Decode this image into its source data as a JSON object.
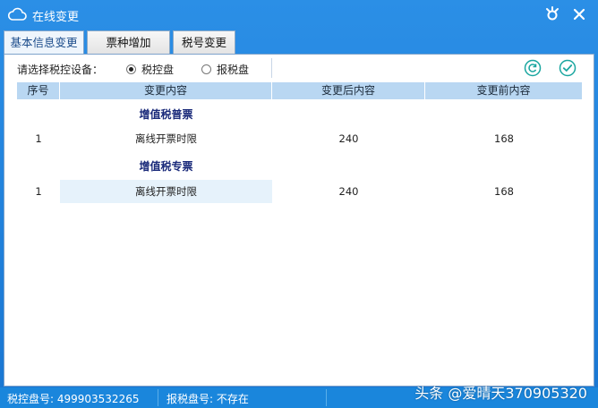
{
  "window": {
    "title": "在线变更",
    "cloud_icon": "cloud-icon",
    "settings_icon": "settings-icon",
    "close_icon": "close-icon"
  },
  "tabs": [
    {
      "label": "基本信息变更",
      "active": true
    },
    {
      "label": "票种增加",
      "active": false
    },
    {
      "label": "税号变更",
      "active": false
    }
  ],
  "device": {
    "label": "请选择税控设备：",
    "options": [
      {
        "label": "税控盘",
        "selected": true
      },
      {
        "label": "报税盘",
        "selected": false
      }
    ]
  },
  "toolbar": {
    "refresh_icon": "refresh-icon",
    "confirm_icon": "check-icon"
  },
  "table": {
    "headers": [
      "序号",
      "变更内容",
      "变更后内容",
      "变更前内容"
    ],
    "groups": [
      {
        "title": "增值税普票",
        "rows": [
          [
            "1",
            "离线开票时限",
            "240",
            "168"
          ]
        ]
      },
      {
        "title": "增值税专票",
        "rows": [
          [
            "1",
            "离线开票时限",
            "240",
            "168"
          ]
        ]
      }
    ]
  },
  "status": {
    "tax_disk": "税控盘号: 499903532265",
    "report_disk": "报税盘号: 不存在"
  },
  "watermark": "头条 @爱晴天370905320",
  "colors": {
    "titlebar": "#1f7fd6",
    "header_bg": "#b9d7f2",
    "group_title": "#1a2a7a",
    "icon_teal": "#1aa6a0"
  }
}
